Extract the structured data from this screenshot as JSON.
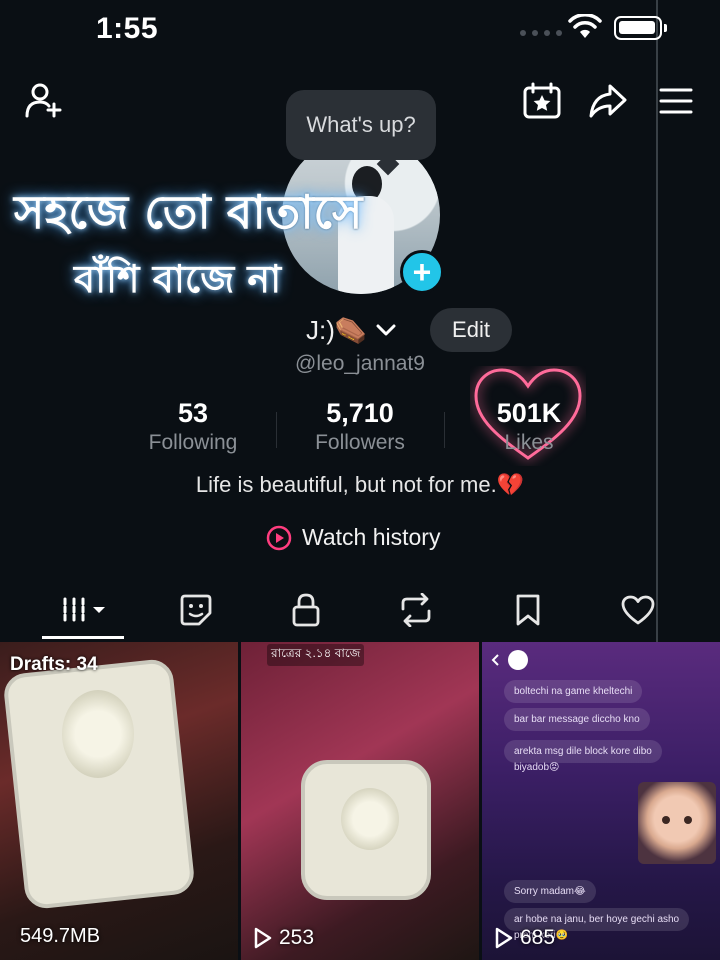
{
  "status_bar": {
    "time": "1:55"
  },
  "profile": {
    "bubble_text": "What's up?",
    "overlay_line1": "সহজে তো বাতাসে",
    "overlay_line2": "বাঁশি বাজে না",
    "name": "J:)⚰️",
    "edit_label": "Edit",
    "handle": "@leo_jannat9",
    "bio": "Life is beautiful, but not for me.💔"
  },
  "stats": [
    {
      "value": "53",
      "label": "Following"
    },
    {
      "value": "5,710",
      "label": "Followers"
    },
    {
      "value": "501K",
      "label": "Likes"
    }
  ],
  "watch_history_label": "Watch history",
  "tabs": [
    "videos-tab",
    "favorites-tab",
    "private-tab",
    "reposts-tab",
    "saved-tab",
    "liked-tab"
  ],
  "videos": [
    {
      "badge": "Drafts: 34",
      "size": "549.7MB"
    },
    {
      "caption": "রাত্রের ২.১৪ বাজে",
      "views": "253"
    },
    {
      "views": "685",
      "messages": [
        "boltechi na game kheltechi",
        "bar bar message diccho kno",
        "arekta msg dile block kore dibo",
        "biyadob😡",
        "Sorry madam😂",
        "ar hobe na janu, ber hoye gechi asho",
        "prem kori🥹"
      ]
    }
  ],
  "colors": {
    "accent_cyan": "#22c5e8",
    "likes_heart": "#ff6b9a",
    "background": "#0a0f14"
  }
}
